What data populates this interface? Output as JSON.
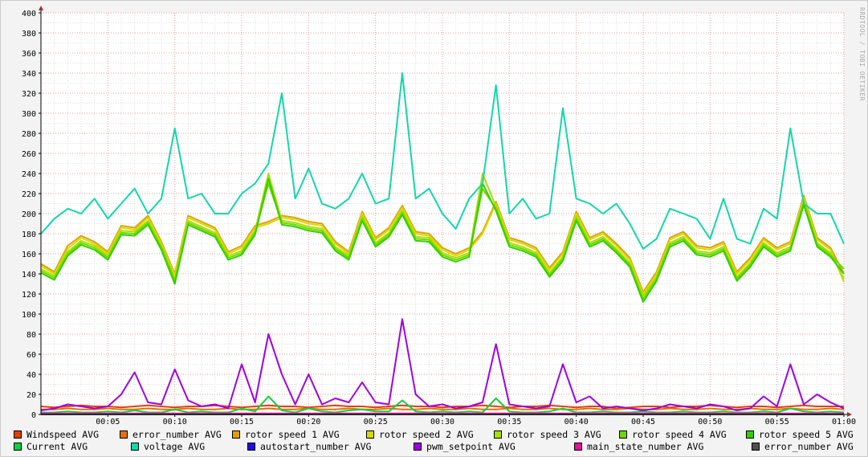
{
  "chart_data": {
    "type": "line",
    "title": "",
    "watermark": "RRDTOOL / TOBI OETIKER",
    "ylim": [
      0,
      400
    ],
    "yticks": [
      0,
      20,
      40,
      60,
      80,
      100,
      120,
      140,
      160,
      180,
      200,
      220,
      240,
      260,
      280,
      300,
      320,
      340,
      360,
      380,
      400
    ],
    "xlim_minutes": [
      0,
      60
    ],
    "xticks": [
      {
        "m": 5,
        "label": "00:05"
      },
      {
        "m": 10,
        "label": "00:10"
      },
      {
        "m": 15,
        "label": "00:15"
      },
      {
        "m": 20,
        "label": "00:20"
      },
      {
        "m": 25,
        "label": "00:25"
      },
      {
        "m": 30,
        "label": "00:30"
      },
      {
        "m": 35,
        "label": "00:35"
      },
      {
        "m": 40,
        "label": "00:40"
      },
      {
        "m": 45,
        "label": "00:45"
      },
      {
        "m": 50,
        "label": "00:50"
      },
      {
        "m": 55,
        "label": "00:55"
      },
      {
        "m": 60,
        "label": "01:00"
      }
    ],
    "grid": true,
    "legend_position": "bottom",
    "x_minutes_step": 1,
    "series": [
      {
        "name": "Windspeed AVG",
        "color": "#e0400a",
        "values": [
          8,
          7,
          8,
          9,
          8,
          8,
          7,
          8,
          9,
          8,
          7,
          8,
          8,
          9,
          8,
          7,
          8,
          9,
          8,
          8,
          7,
          8,
          9,
          8,
          8,
          7,
          8,
          9,
          8,
          8,
          7,
          8,
          8,
          9,
          8,
          7,
          8,
          8,
          9,
          8,
          7,
          8,
          8,
          6,
          7,
          8,
          8,
          7,
          8,
          8,
          9,
          8,
          7,
          8,
          8,
          7,
          8,
          9,
          8,
          8,
          8
        ]
      },
      {
        "name": "error_number AVG",
        "color": "#e07010",
        "values": [
          5,
          5,
          6,
          5,
          5,
          6,
          5,
          5,
          6,
          5,
          5,
          6,
          5,
          5,
          6,
          5,
          5,
          6,
          5,
          5,
          6,
          5,
          5,
          6,
          5,
          5,
          6,
          5,
          5,
          6,
          5,
          5,
          6,
          5,
          5,
          6,
          5,
          5,
          6,
          5,
          5,
          6,
          5,
          5,
          6,
          5,
          5,
          6,
          5,
          5,
          6,
          5,
          5,
          6,
          5,
          5,
          6,
          5,
          5,
          6,
          5
        ]
      },
      {
        "name": "rotor speed 1 AVG",
        "color": "#e0a000",
        "values": [
          150,
          142,
          168,
          178,
          172,
          162,
          188,
          186,
          198,
          172,
          140,
          198,
          192,
          186,
          162,
          168,
          188,
          192,
          198,
          196,
          192,
          190,
          172,
          162,
          202,
          176,
          186,
          208,
          182,
          180,
          166,
          160,
          166,
          182,
          212,
          176,
          172,
          166,
          146,
          162,
          202,
          176,
          182,
          170,
          156,
          122,
          142,
          176,
          182,
          168,
          166,
          172,
          142,
          156,
          176,
          166,
          172,
          218,
          176,
          166,
          140
        ]
      },
      {
        "name": "rotor speed 2 AVG",
        "color": "#d8d800",
        "values": [
          148,
          140,
          165,
          176,
          170,
          160,
          186,
          184,
          196,
          170,
          138,
          196,
          190,
          184,
          160,
          166,
          186,
          190,
          196,
          194,
          190,
          188,
          170,
          160,
          200,
          174,
          184,
          206,
          180,
          178,
          164,
          158,
          164,
          180,
          210,
          174,
          170,
          164,
          144,
          160,
          200,
          174,
          180,
          168,
          154,
          120,
          140,
          174,
          180,
          166,
          164,
          170,
          140,
          154,
          174,
          164,
          170,
          216,
          174,
          164,
          132
        ]
      },
      {
        "name": "rotor speed 3 AVG",
        "color": "#a8e000",
        "values": [
          145,
          138,
          162,
          173,
          168,
          158,
          183,
          182,
          193,
          168,
          135,
          193,
          187,
          181,
          158,
          163,
          183,
          240,
          193,
          191,
          187,
          185,
          167,
          158,
          197,
          171,
          181,
          203,
          177,
          176,
          161,
          156,
          161,
          240,
          207,
          171,
          167,
          161,
          141,
          157,
          197,
          171,
          177,
          165,
          151,
          118,
          137,
          171,
          177,
          163,
          161,
          167,
          137,
          151,
          171,
          161,
          167,
          213,
          171,
          161,
          135
        ]
      },
      {
        "name": "rotor speed 4 AVG",
        "color": "#70d800",
        "values": [
          143,
          136,
          160,
          171,
          166,
          156,
          181,
          180,
          191,
          166,
          133,
          191,
          185,
          179,
          156,
          161,
          181,
          230,
          191,
          189,
          185,
          183,
          165,
          156,
          195,
          169,
          179,
          201,
          175,
          174,
          159,
          154,
          159,
          225,
          205,
          169,
          165,
          159,
          139,
          155,
          195,
          169,
          175,
          163,
          149,
          115,
          135,
          169,
          175,
          161,
          159,
          165,
          135,
          149,
          169,
          159,
          165,
          211,
          169,
          159,
          145
        ]
      },
      {
        "name": "rotor speed 5 AVG",
        "color": "#30d000",
        "values": [
          141,
          134,
          158,
          169,
          164,
          154,
          179,
          178,
          189,
          164,
          130,
          189,
          183,
          177,
          154,
          159,
          179,
          235,
          189,
          187,
          183,
          181,
          163,
          154,
          193,
          167,
          177,
          199,
          173,
          172,
          157,
          152,
          157,
          230,
          203,
          167,
          163,
          157,
          137,
          153,
          193,
          167,
          173,
          161,
          147,
          112,
          133,
          167,
          173,
          159,
          157,
          163,
          133,
          147,
          167,
          157,
          163,
          209,
          167,
          157,
          140
        ]
      },
      {
        "name": "Current AVG",
        "color": "#10d040",
        "values": [
          2,
          2,
          3,
          2,
          2,
          3,
          2,
          4,
          2,
          2,
          5,
          2,
          3,
          2,
          2,
          6,
          3,
          18,
          4,
          2,
          6,
          3,
          2,
          4,
          5,
          3,
          3,
          14,
          3,
          2,
          3,
          2,
          3,
          2,
          16,
          3,
          2,
          2,
          3,
          6,
          2,
          2,
          3,
          2,
          2,
          3,
          2,
          2,
          3,
          2,
          2,
          3,
          2,
          2,
          3,
          2,
          6,
          3,
          2,
          3,
          2
        ]
      },
      {
        "name": "voltage AVG",
        "color": "#10d8a8",
        "values": [
          180,
          195,
          205,
          200,
          215,
          195,
          210,
          225,
          200,
          215,
          285,
          215,
          220,
          200,
          200,
          220,
          230,
          250,
          320,
          215,
          245,
          210,
          205,
          215,
          240,
          210,
          215,
          340,
          215,
          225,
          200,
          185,
          215,
          230,
          328,
          200,
          215,
          195,
          200,
          305,
          215,
          210,
          200,
          210,
          190,
          165,
          175,
          205,
          200,
          195,
          175,
          215,
          175,
          170,
          205,
          195,
          285,
          210,
          200,
          200,
          170
        ]
      },
      {
        "name": "autostart_number AVG",
        "color": "#2010e0",
        "values": [
          0,
          0,
          0,
          0,
          0,
          0,
          0,
          0,
          0,
          0,
          0,
          0,
          0,
          0,
          0,
          0,
          0,
          0,
          0,
          0,
          0,
          0,
          0,
          0,
          0,
          0,
          0,
          0,
          0,
          0,
          0,
          0,
          0,
          0,
          0,
          0,
          0,
          0,
          0,
          0,
          0,
          0,
          0,
          0,
          0,
          0,
          0,
          0,
          0,
          0,
          0,
          0,
          0,
          0,
          0,
          0,
          0,
          0,
          0,
          0,
          0
        ]
      },
      {
        "name": "pwm_setpoint AVG",
        "color": "#a000e0",
        "values": [
          4,
          6,
          10,
          8,
          6,
          8,
          20,
          42,
          12,
          10,
          45,
          14,
          8,
          10,
          6,
          50,
          12,
          80,
          40,
          10,
          40,
          10,
          16,
          12,
          32,
          12,
          10,
          95,
          20,
          8,
          10,
          6,
          8,
          12,
          70,
          10,
          8,
          6,
          8,
          50,
          12,
          18,
          6,
          8,
          6,
          4,
          6,
          10,
          8,
          6,
          10,
          8,
          4,
          6,
          18,
          8,
          50,
          10,
          20,
          12,
          6
        ]
      },
      {
        "name": "main_state_number AVG",
        "color": "#e010a0",
        "values": [
          1,
          1,
          1,
          1,
          1,
          1,
          1,
          1,
          1,
          1,
          1,
          1,
          1,
          1,
          1,
          1,
          1,
          1,
          1,
          1,
          1,
          1,
          1,
          1,
          1,
          1,
          1,
          1,
          1,
          1,
          1,
          1,
          1,
          1,
          1,
          1,
          1,
          1,
          1,
          1,
          1,
          1,
          1,
          1,
          1,
          1,
          1,
          1,
          1,
          1,
          1,
          1,
          1,
          1,
          1,
          1,
          1,
          1,
          1,
          1,
          1
        ]
      },
      {
        "name": "error_number AVG",
        "color": "#505050",
        "values": [
          0,
          0,
          0,
          0,
          0,
          0,
          0,
          0,
          0,
          0,
          0,
          0,
          0,
          0,
          0,
          0,
          0,
          0,
          0,
          0,
          0,
          0,
          0,
          0,
          0,
          0,
          0,
          0,
          0,
          0,
          0,
          0,
          0,
          0,
          0,
          0,
          0,
          0,
          0,
          0,
          0,
          0,
          0,
          0,
          0,
          0,
          0,
          0,
          0,
          0,
          0,
          0,
          0,
          0,
          0,
          0,
          0,
          0,
          0,
          0,
          0
        ]
      }
    ]
  }
}
